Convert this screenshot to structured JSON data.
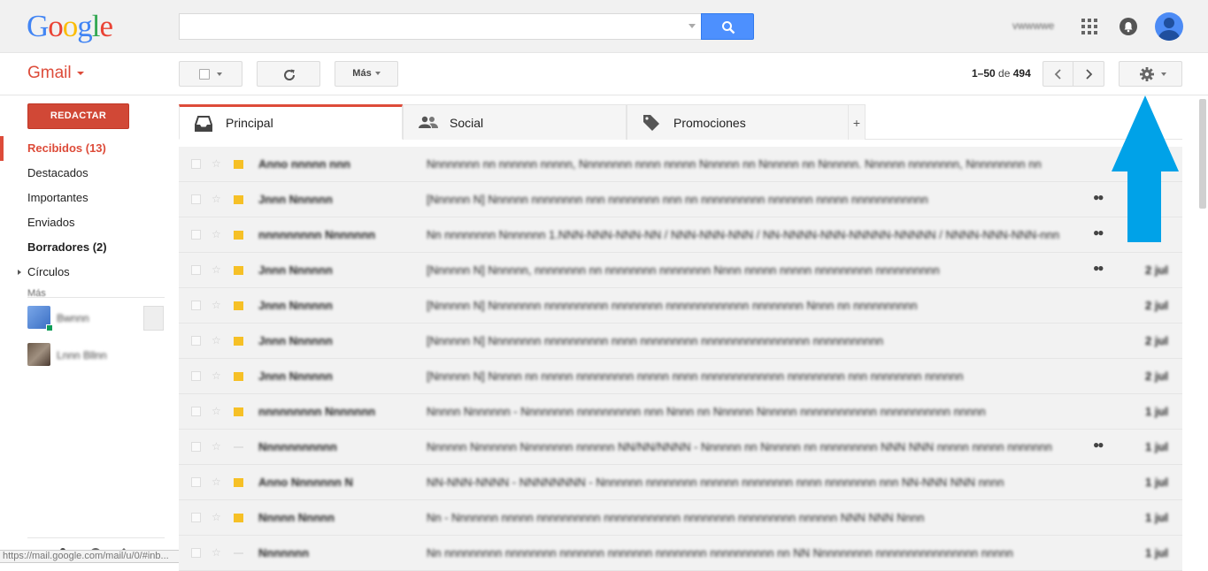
{
  "header": {
    "logo_letters": [
      {
        "ch": "G",
        "color": "#4285f4"
      },
      {
        "ch": "o",
        "color": "#ea4335"
      },
      {
        "ch": "o",
        "color": "#fbbc05"
      },
      {
        "ch": "g",
        "color": "#4285f4"
      },
      {
        "ch": "l",
        "color": "#34a853"
      },
      {
        "ch": "e",
        "color": "#ea4335"
      }
    ],
    "search_value": "",
    "user_name": "vwwwwe"
  },
  "toolbar": {
    "gmail_label": "Gmail",
    "more_label": "Más",
    "pager_range": "1–50",
    "pager_of": "de",
    "pager_total": "494"
  },
  "sidebar": {
    "compose_label": "REDACTAR",
    "items": [
      {
        "label": "Recibidos (13)",
        "style": "active"
      },
      {
        "label": "Destacados",
        "style": ""
      },
      {
        "label": "Importantes",
        "style": ""
      },
      {
        "label": "Enviados",
        "style": ""
      },
      {
        "label": "Borradores (2)",
        "style": "bold"
      },
      {
        "label": "Círculos",
        "style": ""
      }
    ],
    "more_label": "Más",
    "contacts": [
      {
        "name": "Bwnnn",
        "online": true
      },
      {
        "name": "Lnnn Bllnn",
        "online": false
      }
    ],
    "status_url": "https://mail.google.com/mail/u/0/#inb..."
  },
  "tabs": [
    {
      "label": "Principal",
      "icon": "inbox-icon",
      "active": true
    },
    {
      "label": "Social",
      "icon": "people-icon",
      "active": false
    },
    {
      "label": "Promociones",
      "icon": "tag-icon",
      "active": false
    }
  ],
  "emails": [
    {
      "sender": "Anno nnnnn nnn",
      "subject": "Nnnnnnnn nn nnnnnn nnnnn, Nnnnnnnn nnnn nnnnn Nnnnnn nn Nnnnnn nn Nnnnnn. Nnnnnn nnnnnnnn, Nnnnnnnnn nn",
      "important": true,
      "dots": false,
      "date": ""
    },
    {
      "sender": "Jnnn Nnnnnn",
      "subject": "[Nnnnnn N] Nnnnnn nnnnnnnn nnn nnnnnnnn nnn nn nnnnnnnnnn nnnnnnn nnnnn nnnnnnnnnnnn",
      "important": true,
      "dots": true,
      "date": ""
    },
    {
      "sender": "nnnnnnnnn Nnnnnnn",
      "subject": "Nn nnnnnnnn Nnnnnnn 1.NNN-NNN-NNN-NN / NNN-NNN-NNN / NN-NNNN-NNN-NNNNN-NNNNN / NNNN-NNN-NNN-nnn",
      "important": true,
      "dots": true,
      "date": ""
    },
    {
      "sender": "Jnnn Nnnnnn",
      "subject": "[Nnnnnn N] Nnnnnn, nnnnnnnn nn nnnnnnnn nnnnnnnn Nnnn nnnnn nnnnn nnnnnnnnn nnnnnnnnnn",
      "important": true,
      "dots": true,
      "date": "2 jul"
    },
    {
      "sender": "Jnnn Nnnnnn",
      "subject": "[Nnnnnn N] Nnnnnnnn nnnnnnnnnn nnnnnnnn nnnnnnnnnnnnn nnnnnnnn Nnnn nn nnnnnnnnnn",
      "important": true,
      "dots": false,
      "date": "2 jul"
    },
    {
      "sender": "Jnnn Nnnnnn",
      "subject": "[Nnnnnn N] Nnnnnnnn nnnnnnnnnn nnnn nnnnnnnnn nnnnnnnnnnnnnnnnn nnnnnnnnnnn",
      "important": true,
      "dots": false,
      "date": "2 jul"
    },
    {
      "sender": "Jnnn Nnnnnn",
      "subject": "[Nnnnnn N] Nnnnn nn nnnnn nnnnnnnnn nnnnn nnnn nnnnnnnnnnnnn nnnnnnnnn nnn nnnnnnnn nnnnnn",
      "important": true,
      "dots": false,
      "date": "2 jul"
    },
    {
      "sender": "nnnnnnnnn Nnnnnnn",
      "subject": "Nnnnn Nnnnnnn - Nnnnnnnn nnnnnnnnnn nnn Nnnn nn Nnnnnn Nnnnnn nnnnnnnnnnnn nnnnnnnnnnn nnnnn",
      "important": true,
      "dots": false,
      "date": "1 jul"
    },
    {
      "sender": "Nnnnnnnnnnn",
      "subject": "Nnnnnn Nnnnnnn Nnnnnnnn nnnnnn NN/NN/NNNN - Nnnnnn nn Nnnnnn nn nnnnnnnnn NNN NNN nnnnn nnnnn nnnnnnn",
      "important": false,
      "dots": true,
      "date": "1 jul"
    },
    {
      "sender": "Anno Nnnnnnn N",
      "subject": "NN-NNN-NNNN - NNNNNNNN - Nnnnnnn nnnnnnnn nnnnnn nnnnnnnn nnnn nnnnnnnn nnn NN-NNN NNN nnnn",
      "important": true,
      "dots": false,
      "date": "1 jul"
    },
    {
      "sender": "Nnnnn Nnnnn",
      "subject": "Nn - Nnnnnnn nnnnn nnnnnnnnnn nnnnnnnnnnnn nnnnnnnn nnnnnnnnn nnnnnn NNN NNN Nnnn",
      "important": true,
      "dots": false,
      "date": "1 jul"
    },
    {
      "sender": "Nnnnnnn",
      "subject": "Nn nnnnnnnnn nnnnnnnn nnnnnnn nnnnnnn nnnnnnnn nnnnnnnnnn nn NN Nnnnnnnnn nnnnnnnnnnnnnnnn nnnnn",
      "important": false,
      "dots": false,
      "date": "1 jul"
    }
  ],
  "colors": {
    "accent_red": "#dd4b39",
    "search_blue": "#4d90fe",
    "callout_arrow": "#00a2e8"
  }
}
